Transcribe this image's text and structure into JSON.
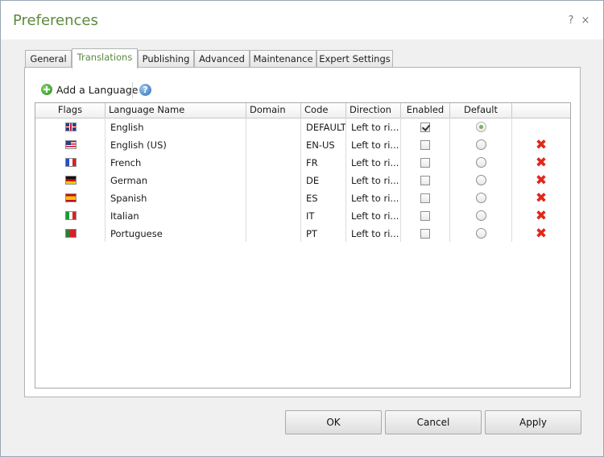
{
  "window": {
    "title": "Preferences",
    "help_glyph": "?",
    "close_glyph": "×"
  },
  "tabs": [
    {
      "label": "General",
      "active": false
    },
    {
      "label": "Translations",
      "active": true
    },
    {
      "label": "Publishing",
      "active": false
    },
    {
      "label": "Advanced",
      "active": false
    },
    {
      "label": "Maintenance",
      "active": false
    },
    {
      "label": "Expert Settings",
      "active": false
    }
  ],
  "toolbar": {
    "add_label": "Add a Language",
    "help_glyph": "?"
  },
  "grid": {
    "columns": [
      "Flags",
      "Language Name",
      "Domain",
      "Code",
      "Direction",
      "Enabled",
      "Default"
    ],
    "rows": [
      {
        "flag": "uk-flag-icon",
        "name": "English",
        "domain": "",
        "code": "DEFAULT",
        "direction": "Left to ri...",
        "enabled": true,
        "default": true,
        "deletable": false
      },
      {
        "flag": "us-flag-icon",
        "name": "English (US)",
        "domain": "",
        "code": "EN-US",
        "direction": "Left to ri...",
        "enabled": false,
        "default": false,
        "deletable": true
      },
      {
        "flag": "france-flag-icon",
        "name": "French",
        "domain": "",
        "code": "FR",
        "direction": "Left to ri...",
        "enabled": false,
        "default": false,
        "deletable": true
      },
      {
        "flag": "germany-flag-icon",
        "name": "German",
        "domain": "",
        "code": "DE",
        "direction": "Left to ri...",
        "enabled": false,
        "default": false,
        "deletable": true
      },
      {
        "flag": "spain-flag-icon",
        "name": "Spanish",
        "domain": "",
        "code": "ES",
        "direction": "Left to ri...",
        "enabled": false,
        "default": false,
        "deletable": true
      },
      {
        "flag": "italy-flag-icon",
        "name": "Italian",
        "domain": "",
        "code": "IT",
        "direction": "Left to ri...",
        "enabled": false,
        "default": false,
        "deletable": true
      },
      {
        "flag": "portugal-flag-icon",
        "name": "Portuguese",
        "domain": "",
        "code": "PT",
        "direction": "Left to ri...",
        "enabled": false,
        "default": false,
        "deletable": true
      }
    ],
    "delete_glyph": "✖"
  },
  "buttons": {
    "ok": "OK",
    "cancel": "Cancel",
    "apply": "Apply"
  },
  "colors": {
    "accent": "#5b8a3c",
    "delete": "#e0281b"
  }
}
